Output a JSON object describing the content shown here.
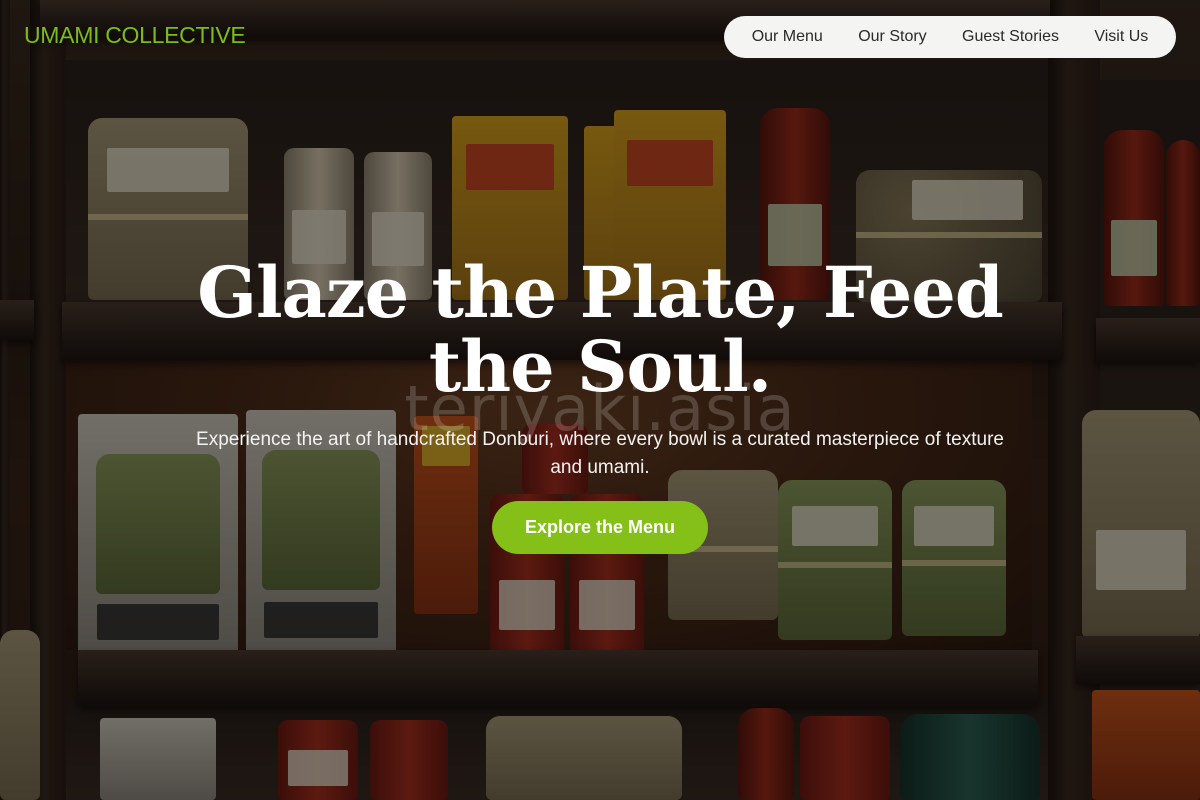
{
  "brand": {
    "name": "UMAMI COLLECTIVE",
    "accent_color": "#84c018"
  },
  "nav": {
    "items": [
      {
        "label": "Our Menu"
      },
      {
        "label": "Our Story"
      },
      {
        "label": "Guest Stories"
      },
      {
        "label": "Visit Us"
      }
    ]
  },
  "hero": {
    "title": "Glaze the Plate, Feed the Soul.",
    "subtitle": "Experience the art of handcrafted Donburi, where every bowl is a curated masterpiece of texture and umami.",
    "cta_label": "Explore the Menu",
    "watermark": "teriyaki.asia"
  },
  "background": {
    "description_icon": "pantry-shelves-photo"
  }
}
